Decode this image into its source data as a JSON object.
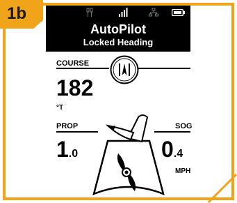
{
  "badge": "1b",
  "header": {
    "title": "AutoPilot",
    "subtitle": "Locked Heading"
  },
  "course": {
    "label": "COURSE",
    "value": "182",
    "unit": "°T"
  },
  "prop": {
    "label": "PROP",
    "value_int": "1",
    "value_dec": ".0"
  },
  "sog": {
    "label": "SOG",
    "value_int": "0",
    "value_dec": ".4",
    "unit": "MPH"
  },
  "icons": [
    "network-icon",
    "signal-icon",
    "ethernet-icon",
    "battery-icon",
    "autopilot-mode-icon",
    "motor-direction-icon"
  ],
  "colors": {
    "accent": "#f0a419",
    "header_bg": "#000000",
    "text": "#000000"
  }
}
